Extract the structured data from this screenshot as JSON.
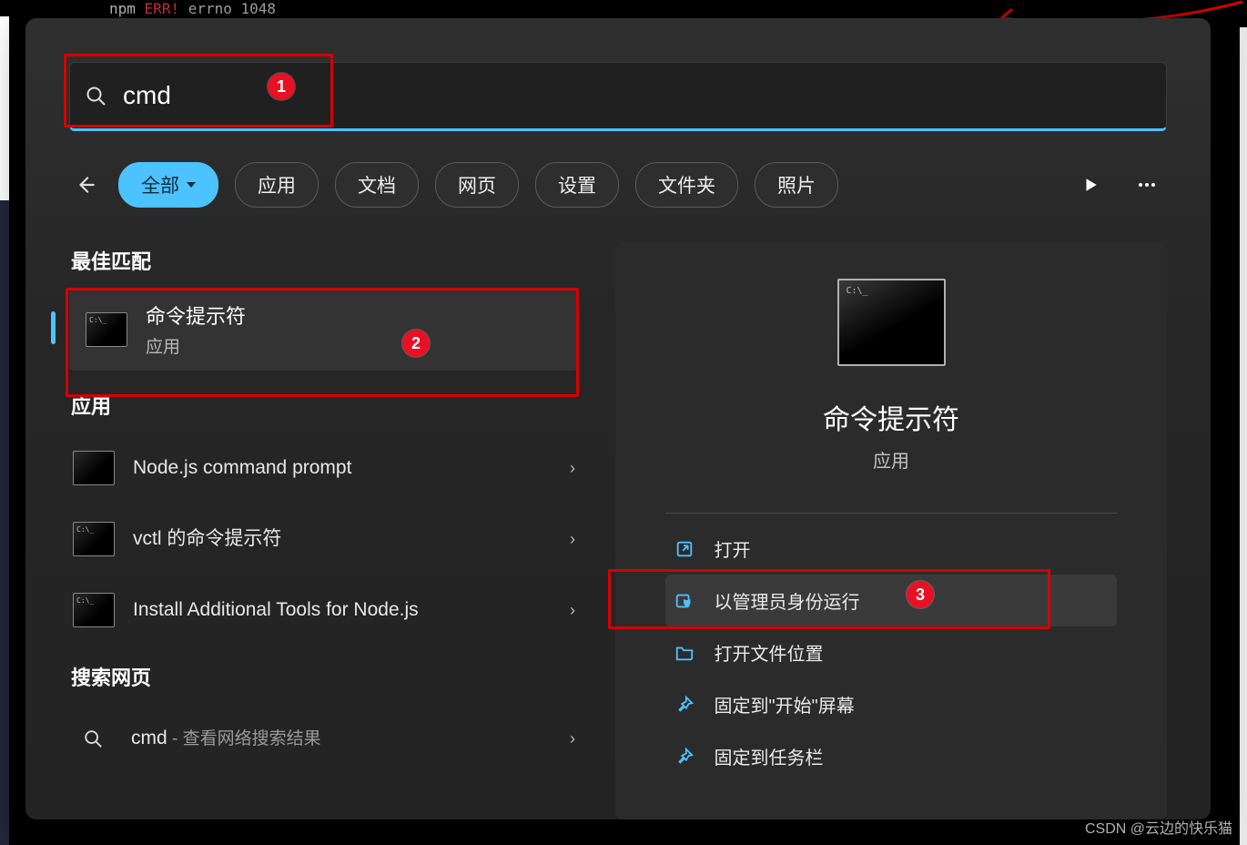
{
  "terminal": {
    "npm": "npm",
    "err": "ERR!",
    "rest": "errno  1048"
  },
  "search": {
    "value": "cmd"
  },
  "filters": {
    "back_icon": "back-arrow",
    "items": [
      {
        "label": "全部",
        "active": true,
        "dropdown": true
      },
      {
        "label": "应用",
        "active": false,
        "dropdown": false
      },
      {
        "label": "文档",
        "active": false,
        "dropdown": false
      },
      {
        "label": "网页",
        "active": false,
        "dropdown": false
      },
      {
        "label": "设置",
        "active": false,
        "dropdown": false
      },
      {
        "label": "文件夹",
        "active": false,
        "dropdown": false
      },
      {
        "label": "照片",
        "active": false,
        "dropdown": false
      }
    ],
    "play_icon": "play-icon",
    "more_icon": "more-icon"
  },
  "sections": {
    "best_match": "最佳匹配",
    "apps": "应用",
    "web": "搜索网页"
  },
  "best": {
    "title": "命令提示符",
    "subtitle": "应用"
  },
  "apps": [
    {
      "label": "Node.js command prompt"
    },
    {
      "label": "vctl 的命令提示符"
    },
    {
      "label": "Install Additional Tools for Node.js"
    }
  ],
  "web": {
    "term": "cmd",
    "suffix": " - 查看网络搜索结果"
  },
  "preview": {
    "title": "命令提示符",
    "subtitle": "应用",
    "actions": [
      {
        "label": "打开",
        "icon": "open-icon"
      },
      {
        "label": "以管理员身份运行",
        "icon": "admin-shield-icon",
        "selected": true
      },
      {
        "label": "打开文件位置",
        "icon": "folder-icon"
      },
      {
        "label": "固定到\"开始\"屏幕",
        "icon": "pin-icon"
      },
      {
        "label": "固定到任务栏",
        "icon": "pin-icon"
      }
    ]
  },
  "annotations": {
    "a1": "1",
    "a2": "2",
    "a3": "3"
  },
  "watermark": "CSDN @云边的快乐猫"
}
